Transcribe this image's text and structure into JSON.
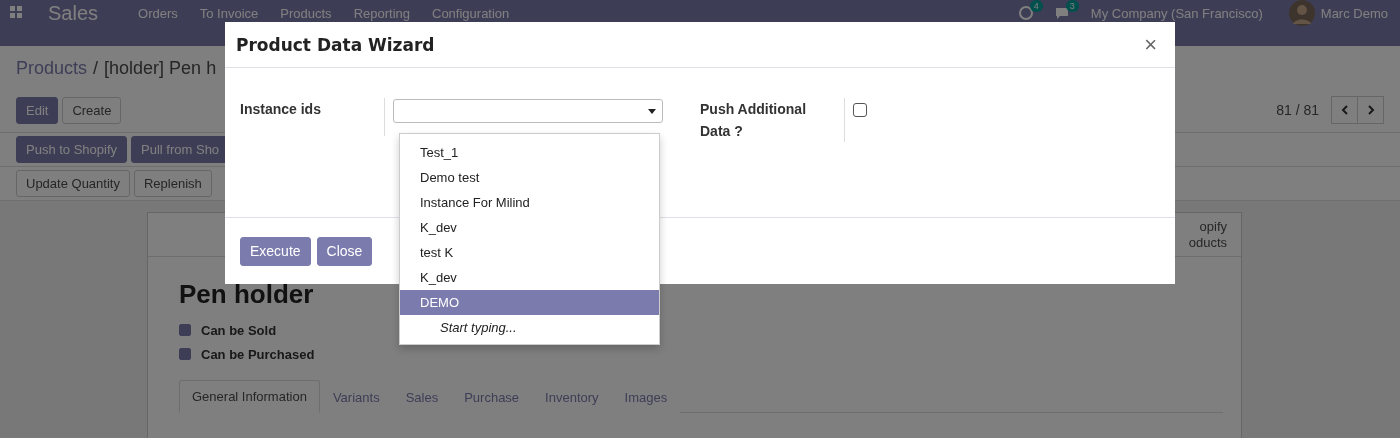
{
  "app": {
    "title": "Sales",
    "menu": [
      {
        "label": "Orders"
      },
      {
        "label": "To Invoice"
      },
      {
        "label": "Products"
      },
      {
        "label": "Reporting"
      },
      {
        "label": "Configuration"
      }
    ],
    "activity_badge": "4",
    "message_badge": "3",
    "company": "My Company (San Francisco)",
    "user": "Marc Demo"
  },
  "breadcrumb": {
    "parent": "Products",
    "separator": "/",
    "current": "[holder] Pen h"
  },
  "actions": [
    {
      "label": "Edit",
      "kind": "primary"
    },
    {
      "label": "Create",
      "kind": "secondary"
    }
  ],
  "pager": "81 / 81",
  "header_buttons": [
    {
      "label": "Push to Shopify",
      "kind": "primary"
    },
    {
      "label": "Pull from Sho",
      "kind": "primary"
    }
  ],
  "header_buttons_2": [
    {
      "label": "Update Quantity",
      "kind": "secondary"
    },
    {
      "label": "Replenish",
      "kind": "secondary"
    }
  ],
  "sheet": {
    "stat_button": [
      "opify",
      "oducts"
    ],
    "title": "Pen holder",
    "options": [
      {
        "label": "Can be Sold",
        "checked": true
      },
      {
        "label": "Can be Purchased",
        "checked": true
      }
    ],
    "tabs": [
      {
        "label": "General Information",
        "selected": true
      },
      {
        "label": "Variants",
        "selected": false
      },
      {
        "label": "Sales",
        "selected": false
      },
      {
        "label": "Purchase",
        "selected": false
      },
      {
        "label": "Inventory",
        "selected": false
      },
      {
        "label": "Images",
        "selected": false
      }
    ]
  },
  "dialog": {
    "title": "Product Data Wizard",
    "close_glyph": "×",
    "fields": [
      {
        "label": "Instance ids",
        "kind": "select"
      },
      {
        "label": "Push Additional Data ?",
        "kind": "checkbox",
        "checked": false
      }
    ],
    "buttons": [
      "Execute",
      "Close"
    ],
    "dropdown": {
      "options": [
        {
          "label": "Test_1",
          "selected": false
        },
        {
          "label": "Demo test",
          "selected": false
        },
        {
          "label": "Instance For Milind",
          "selected": false
        },
        {
          "label": "K_dev",
          "selected": false
        },
        {
          "label": "test K",
          "selected": false
        },
        {
          "label": "K_dev",
          "selected": false
        },
        {
          "label": "DEMO",
          "selected": true
        }
      ],
      "hint": "Start typing..."
    }
  }
}
